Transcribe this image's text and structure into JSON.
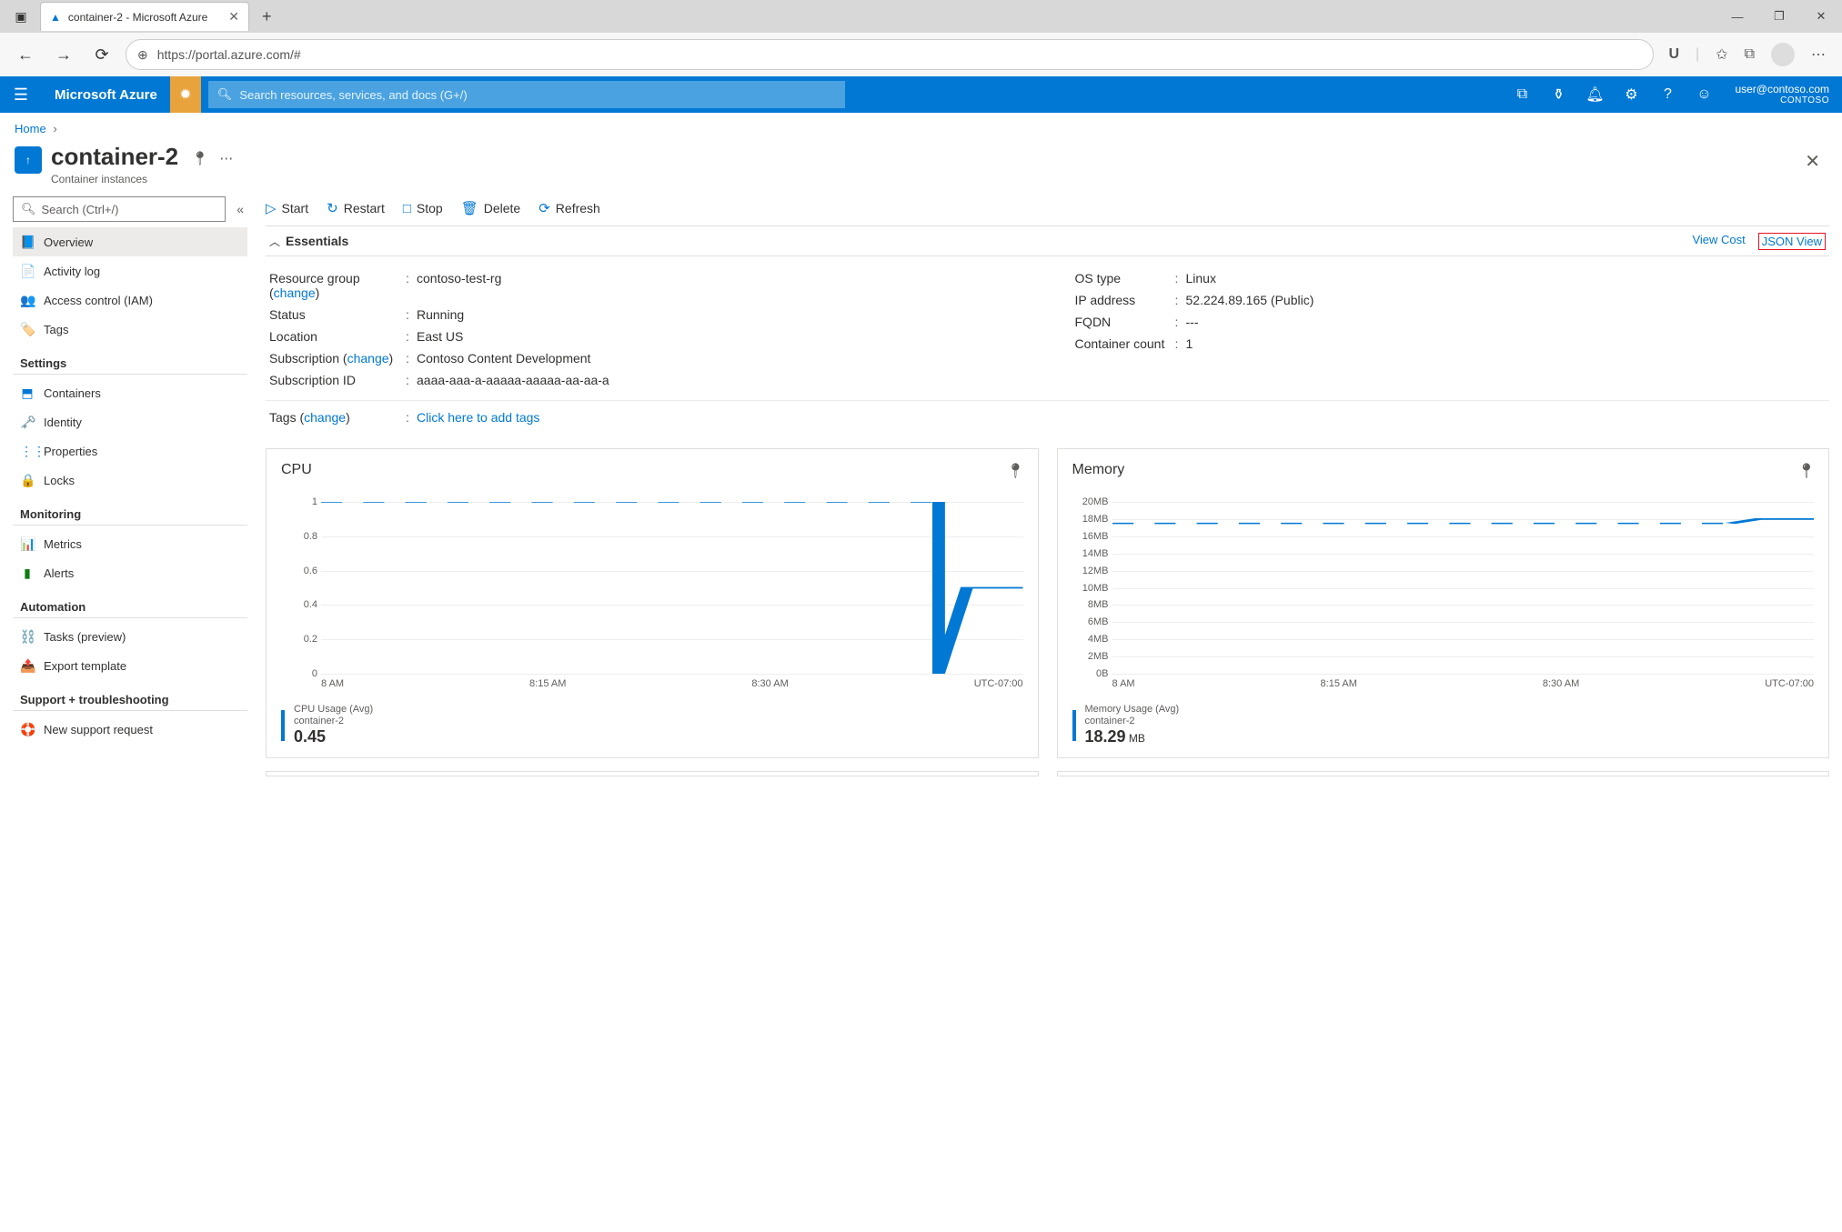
{
  "browser": {
    "tab": {
      "title": "container-2 - Microsoft Azure"
    },
    "url": "https://portal.azure.com/#"
  },
  "azure_bar": {
    "brand": "Microsoft Azure",
    "search_placeholder": "Search resources, services, and docs (G+/)",
    "user": "user@contoso.com",
    "directory": "CONTOSO"
  },
  "breadcrumb": {
    "home": "Home"
  },
  "header": {
    "title": "container-2",
    "subtitle": "Container instances"
  },
  "side_search_placeholder": "Search (Ctrl+/)",
  "nav": {
    "items_top": [
      {
        "label": "Overview",
        "icon": "📘",
        "cls": "icon-blue",
        "active": true
      },
      {
        "label": "Activity log",
        "icon": "📄",
        "cls": "icon-blue"
      },
      {
        "label": "Access control (IAM)",
        "icon": "👥",
        "cls": "icon-blue"
      },
      {
        "label": "Tags",
        "icon": "🏷️",
        "cls": "icon-purple"
      }
    ],
    "group_settings": "Settings",
    "items_settings": [
      {
        "label": "Containers",
        "icon": "⬒",
        "cls": "icon-blue"
      },
      {
        "label": "Identity",
        "icon": "🗝️",
        "cls": "icon-orange"
      },
      {
        "label": "Properties",
        "icon": "⋮⋮",
        "cls": "icon-blue"
      },
      {
        "label": "Locks",
        "icon": "🔒",
        "cls": ""
      }
    ],
    "group_monitoring": "Monitoring",
    "items_monitoring": [
      {
        "label": "Metrics",
        "icon": "📊",
        "cls": "icon-blue"
      },
      {
        "label": "Alerts",
        "icon": "▮",
        "cls": "icon-green"
      }
    ],
    "group_automation": "Automation",
    "items_automation": [
      {
        "label": "Tasks (preview)",
        "icon": "⛓️",
        "cls": ""
      },
      {
        "label": "Export template",
        "icon": "📤",
        "cls": "icon-blue"
      }
    ],
    "group_support": "Support + troubleshooting",
    "items_support": [
      {
        "label": "New support request",
        "icon": "🛟",
        "cls": "icon-blue"
      }
    ]
  },
  "cmd": {
    "start": "Start",
    "restart": "Restart",
    "stop": "Stop",
    "delete": "Delete",
    "refresh": "Refresh"
  },
  "essentials": {
    "title": "Essentials",
    "view_cost": "View Cost",
    "json_view": "JSON View",
    "left": {
      "resource_group_label": "Resource group (",
      "change": "change",
      "rg_close": ")",
      "resource_group_value": "contoso-test-rg",
      "status_label": "Status",
      "status_value": "Running",
      "location_label": "Location",
      "location_value": "East US",
      "subscription_label": "Subscription (",
      "subscription_value": "Contoso Content Development",
      "subid_label": "Subscription ID",
      "subid_value": "aaaa-aaa-a-aaaaa-aaaaa-aa-aa-a"
    },
    "right": {
      "os_label": "OS type",
      "os_value": "Linux",
      "ip_label": "IP address",
      "ip_value": "52.224.89.165 (Public)",
      "fqdn_label": "FQDN",
      "fqdn_value": "---",
      "cc_label": "Container count",
      "cc_value": "1"
    },
    "tags_label": "Tags (",
    "tags_link": "Click here to add tags"
  },
  "chart_data": [
    {
      "type": "line",
      "title": "CPU",
      "yticks": [
        "1",
        "0.8",
        "0.6",
        "0.4",
        "0.2",
        "0"
      ],
      "xticks": [
        "8 AM",
        "8:15 AM",
        "8:30 AM",
        "UTC-07:00"
      ],
      "stat_label": "CPU Usage (Avg)",
      "stat_sub": "container-2",
      "stat_value": "0.45",
      "stat_unit": "",
      "ylim": [
        0,
        1
      ],
      "series": [
        {
          "name": "CPU Usage (Avg)",
          "style": "dashed-then-solid",
          "points": [
            {
              "x": 0,
              "y": 1
            },
            {
              "x": 0.88,
              "y": 1
            },
            {
              "x": 0.88,
              "y": 0
            },
            {
              "x": 0.92,
              "y": 0.5
            },
            {
              "x": 1.0,
              "y": 0.5
            }
          ]
        }
      ]
    },
    {
      "type": "line",
      "title": "Memory",
      "yticks": [
        "20MB",
        "18MB",
        "16MB",
        "14MB",
        "12MB",
        "10MB",
        "8MB",
        "6MB",
        "4MB",
        "2MB",
        "0B"
      ],
      "xticks": [
        "8 AM",
        "8:15 AM",
        "8:30 AM",
        "UTC-07:00"
      ],
      "stat_label": "Memory Usage (Avg)",
      "stat_sub": "container-2",
      "stat_value": "18.29",
      "stat_unit": " MB",
      "ylim": [
        0,
        20
      ],
      "series": [
        {
          "name": "Memory Usage (Avg)",
          "style": "dashed-then-solid",
          "points": [
            {
              "x": 0,
              "y": 17.5
            },
            {
              "x": 0.88,
              "y": 17.5
            },
            {
              "x": 0.92,
              "y": 18
            },
            {
              "x": 1.0,
              "y": 18
            }
          ]
        }
      ]
    }
  ]
}
